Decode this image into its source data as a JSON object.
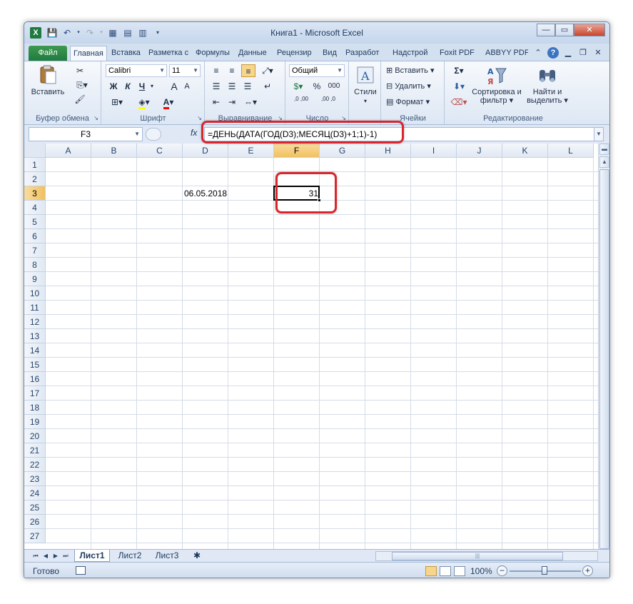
{
  "window": {
    "title": "Книга1  -  Microsoft Excel",
    "app_icon": "X",
    "qat_icons": [
      "save-icon",
      "undo-icon",
      "redo-icon",
      "form-icon",
      "table-icon",
      "calculator-icon",
      "customize-qat-icon"
    ],
    "controls": {
      "minimize": "—",
      "restore": "▭",
      "close": "✕"
    }
  },
  "ribbon": {
    "tabs": [
      "Файл",
      "Главная",
      "Вставка",
      "Разметка с",
      "Формулы",
      "Данные",
      "Рецензир",
      "Вид",
      "Разработ",
      "Надстрой",
      "Foxit PDF",
      "ABBYY PDF"
    ],
    "active_tab": "Главная",
    "clipboard": {
      "paste_label": "Вставить",
      "group_label": "Буфер обмена"
    },
    "font": {
      "name": "Calibri",
      "size": "11",
      "bold": "Ж",
      "italic": "К",
      "underline": "Ч",
      "grow": "A",
      "shrink": "A",
      "group_label": "Шрифт",
      "font_color": "#ff0000",
      "fill_color": "#ffff00"
    },
    "alignment": {
      "group_label": "Выравнивание"
    },
    "number": {
      "format": "Общий",
      "currency": "$",
      "percent": "%",
      "thousands": "000",
      "inc_dec": ",0 ,00",
      "dec_dec": ",00 ,0",
      "group_label": "Число"
    },
    "styles": {
      "label": "Стили"
    },
    "cells": {
      "insert": "Вставить",
      "delete": "Удалить",
      "format": "Формат",
      "group_label": "Ячейки"
    },
    "editing": {
      "sum": "Σ",
      "sort_label": "Сортировка и фильтр",
      "find_label": "Найти и выделить",
      "group_label": "Редактирование"
    }
  },
  "formula_bar": {
    "namebox": "F3",
    "fx": "fx",
    "formula": "=ДЕНЬ(ДАТА(ГОД(D3);МЕСЯЦ(D3)+1;1)-1)"
  },
  "grid": {
    "columns": [
      "A",
      "B",
      "C",
      "D",
      "E",
      "F",
      "G",
      "H",
      "I",
      "J",
      "K",
      "L"
    ],
    "rows": [
      "1",
      "2",
      "3",
      "4",
      "5",
      "6",
      "7",
      "8",
      "9",
      "10",
      "11",
      "12",
      "13",
      "14",
      "15",
      "16",
      "17",
      "18",
      "19",
      "20",
      "21",
      "22",
      "23",
      "24",
      "25",
      "26",
      "27"
    ],
    "selected_column": "F",
    "selected_row": "3",
    "cells": {
      "D3": "06.05.2018",
      "F3": "31"
    }
  },
  "sheets": {
    "tabs": [
      "Лист1",
      "Лист2",
      "Лист3"
    ],
    "active": "Лист1"
  },
  "status": {
    "ready": "Готово",
    "zoom": "100%"
  },
  "accent_colors": {
    "highlight_red": "#d8262c",
    "file_tab": "#1f7a3f",
    "selection": "#f1c15f"
  }
}
